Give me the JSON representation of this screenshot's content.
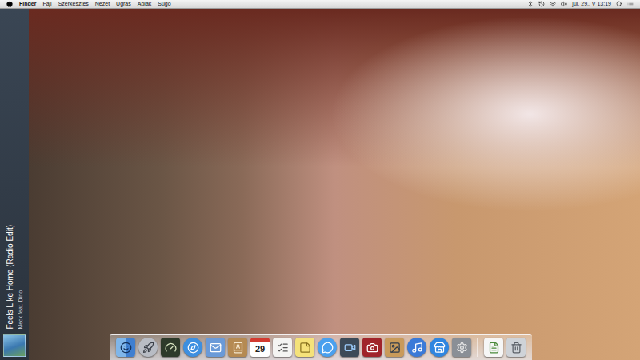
{
  "menu_bar": {
    "app_name": "Finder",
    "menus": [
      "Fájl",
      "Szerkesztés",
      "Nézet",
      "Ugrás",
      "Ablak",
      "Súgó"
    ],
    "clock": "júl. 29., V 13:19"
  },
  "now_playing": {
    "title": "Feels Like Home (Radio Edit)",
    "artist": "Meck feat. Dino"
  },
  "dock": {
    "items": [
      {
        "kind": "finder"
      },
      {
        "kind": "launchpad"
      },
      {
        "kind": "dashboard"
      },
      {
        "kind": "safari"
      },
      {
        "kind": "mail"
      },
      {
        "kind": "contacts"
      },
      {
        "kind": "calendar",
        "text": "29"
      },
      {
        "kind": "reminders"
      },
      {
        "kind": "notes"
      },
      {
        "kind": "messages"
      },
      {
        "kind": "facetime"
      },
      {
        "kind": "photobooth"
      },
      {
        "kind": "iphoto"
      },
      {
        "kind": "itunes"
      },
      {
        "kind": "appstore"
      },
      {
        "kind": "preferences"
      },
      {
        "kind": "separator"
      },
      {
        "kind": "document"
      },
      {
        "kind": "trash"
      }
    ]
  }
}
